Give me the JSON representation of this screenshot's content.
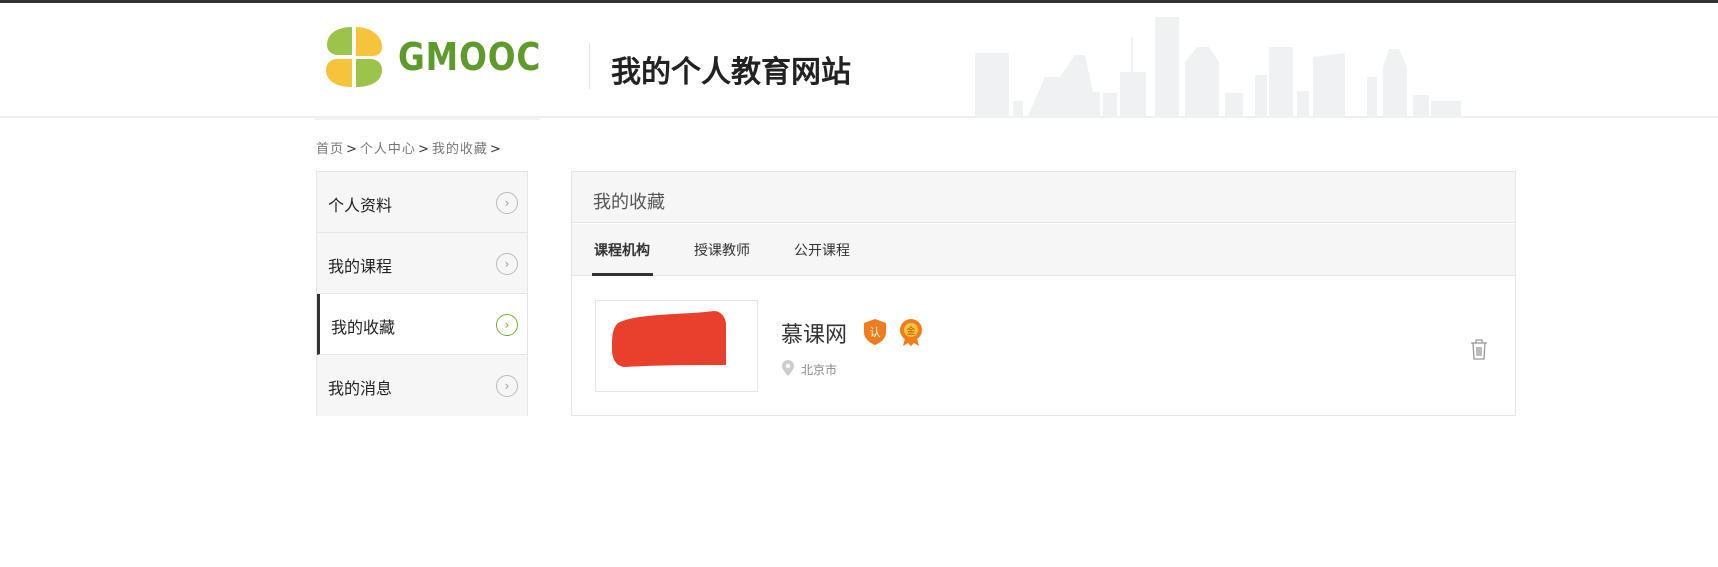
{
  "header": {
    "logo_text": "GMOOC",
    "site_title": "我的个人教育网站"
  },
  "breadcrumb": {
    "items": [
      "首页",
      "个人中心",
      "我的收藏"
    ],
    "separator": ">"
  },
  "sidebar": {
    "items": [
      {
        "label": "个人资料",
        "active": false
      },
      {
        "label": "我的课程",
        "active": false
      },
      {
        "label": "我的收藏",
        "active": true
      },
      {
        "label": "我的消息",
        "active": false
      }
    ],
    "arrow_glyph": "›"
  },
  "panel": {
    "title": "我的收藏",
    "tabs": [
      {
        "label": "课程机构",
        "active": true
      },
      {
        "label": "授课教师",
        "active": false
      },
      {
        "label": "公开课程",
        "active": false
      }
    ],
    "favorites": [
      {
        "name": "慕课网",
        "location": "北京市",
        "badges": [
          "认",
          "金"
        ]
      }
    ]
  },
  "icons": {
    "location": "location-pin-icon",
    "delete": "trash-icon",
    "arrow": "chevron-right-icon"
  },
  "colors": {
    "brand_green": "#5f9a2c",
    "logo_yellow": "#f5c43a",
    "logo_green": "#9cc34a",
    "badge_orange": "#f07d1b",
    "thumb_red": "#e8402c",
    "active_arrow": "#6ab42e"
  }
}
